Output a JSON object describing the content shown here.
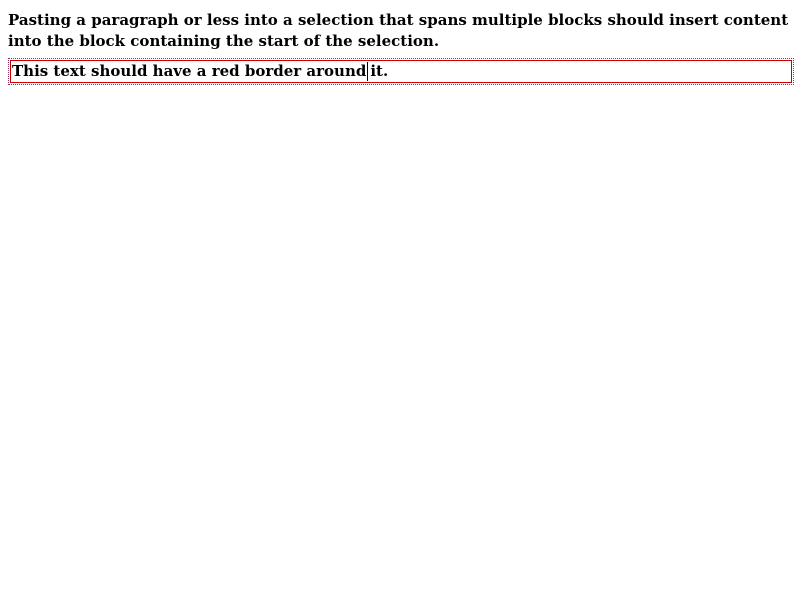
{
  "description": "Pasting a paragraph or less into a selection that spans multiple blocks should insert content into the block containing the start of the selection.",
  "editor": {
    "text_before_caret": "This text should have a red border around",
    "text_after_caret": "it."
  }
}
